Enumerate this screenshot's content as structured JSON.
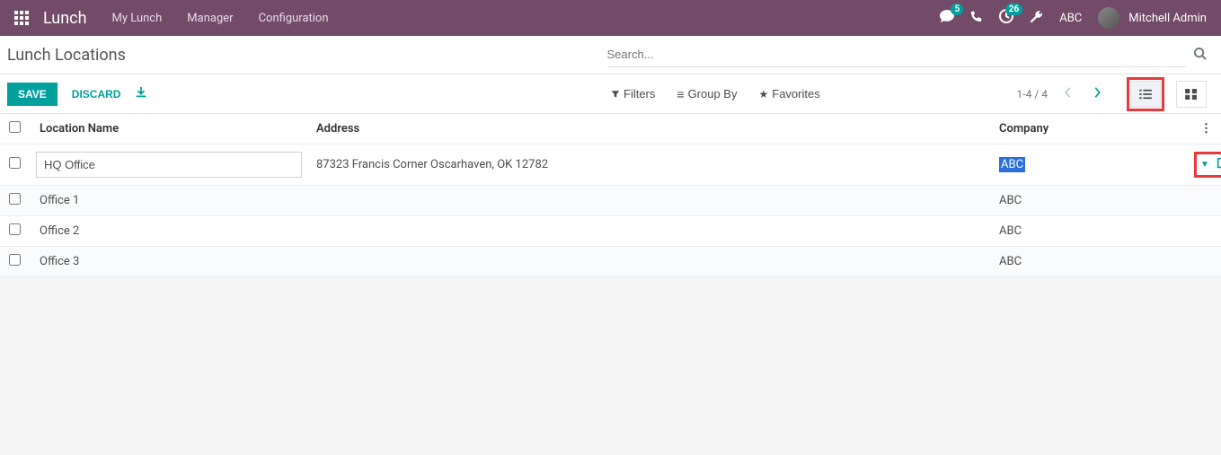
{
  "navbar": {
    "app_name": "Lunch",
    "links": [
      "My Lunch",
      "Manager",
      "Configuration"
    ],
    "chat_count": "5",
    "clock_count": "26",
    "company": "ABC",
    "user_name": "Mitchell Admin"
  },
  "page": {
    "title": "Lunch Locations",
    "search_placeholder": "Search..."
  },
  "controls": {
    "save": "SAVE",
    "discard": "DISCARD",
    "filters": "Filters",
    "group_by": "Group By",
    "favorites": "Favorites",
    "pager": "1-4 / 4"
  },
  "table": {
    "headers": {
      "name": "Location Name",
      "address": "Address",
      "company": "Company"
    },
    "rows": [
      {
        "name": "HQ Office",
        "address": "87323 Francis Corner Oscarhaven, OK 12782",
        "company": "ABC",
        "editing": true
      },
      {
        "name": "Office 1",
        "address": "",
        "company": "ABC",
        "editing": false
      },
      {
        "name": "Office 2",
        "address": "",
        "company": "ABC",
        "editing": false
      },
      {
        "name": "Office 3",
        "address": "",
        "company": "ABC",
        "editing": false
      }
    ]
  }
}
